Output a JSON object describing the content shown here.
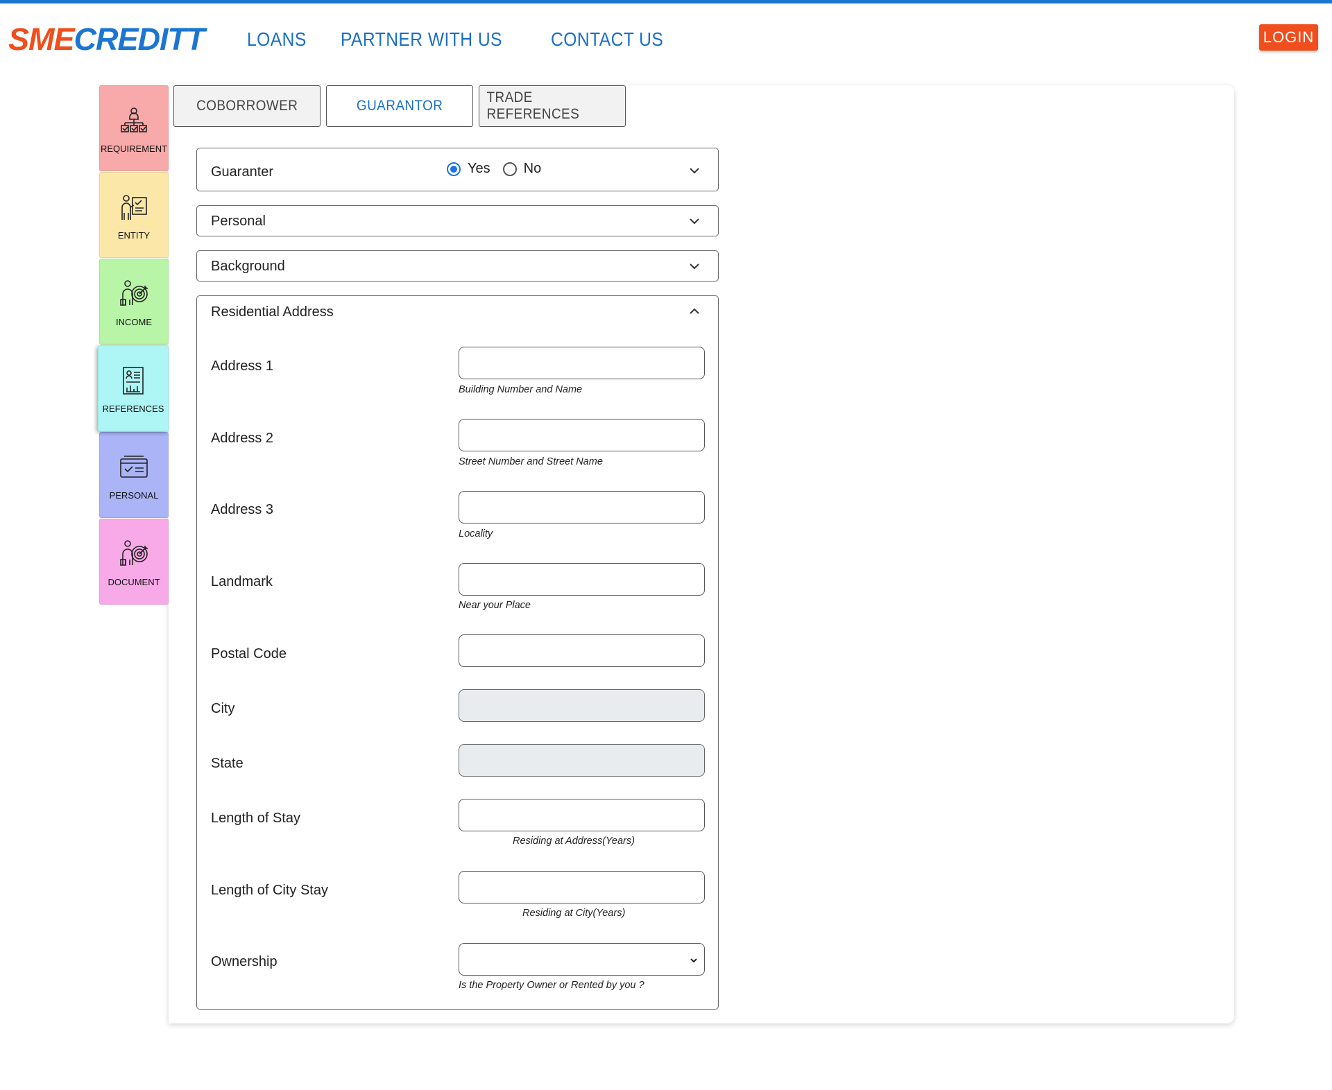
{
  "header": {
    "logo_part1": "SME",
    "logo_part2": "CREDITT",
    "nav": [
      "LOANS",
      "PARTNER WITH US",
      "CONTACT US"
    ],
    "login_label": "LOGIN"
  },
  "sidebar": {
    "items": [
      {
        "label": "REQUIREMENT",
        "color": "#f8a9a9",
        "icon": "org-check-icon"
      },
      {
        "label": "ENTITY",
        "color": "#fbe7a8",
        "icon": "presenter-icon"
      },
      {
        "label": "INCOME",
        "color": "#b8f5a6",
        "icon": "target-person-icon"
      },
      {
        "label": "REFERENCES",
        "color": "#aef6f6",
        "icon": "report-icon",
        "active": true
      },
      {
        "label": "PERSONAL",
        "color": "#aab4f6",
        "icon": "card-check-icon"
      },
      {
        "label": "DOCUMENT",
        "color": "#f8aae8",
        "icon": "target-person-icon"
      }
    ]
  },
  "tabs": [
    {
      "label": "COBORROWER",
      "active": false
    },
    {
      "label": "GUARANTOR",
      "active": true
    },
    {
      "label": "TRADE REFERENCES",
      "active": false
    }
  ],
  "guaranter": {
    "label": "Guaranter",
    "yes_label": "Yes",
    "no_label": "No",
    "selected": "Yes"
  },
  "sections": {
    "personal": "Personal",
    "background": "Background",
    "residential": "Residential Address"
  },
  "address_form": {
    "address1": {
      "label": "Address 1",
      "value": "",
      "hint": "Building Number and Name"
    },
    "address2": {
      "label": "Address 2",
      "value": "",
      "hint": "Street Number and Street Name"
    },
    "address3": {
      "label": "Address 3",
      "value": "",
      "hint": "Locality"
    },
    "landmark": {
      "label": "Landmark",
      "value": "",
      "hint": "Near your Place"
    },
    "postal": {
      "label": "Postal Code",
      "value": ""
    },
    "city": {
      "label": "City",
      "value": ""
    },
    "state": {
      "label": "State",
      "value": ""
    },
    "length_stay": {
      "label": "Length of Stay",
      "value": "",
      "hint": "Residing at Address(Years)"
    },
    "length_city_stay": {
      "label": "Length of City Stay",
      "value": "",
      "hint": "Residing at City(Years)"
    },
    "ownership": {
      "label": "Ownership",
      "value": "",
      "hint": "Is the Property Owner or Rented by you ?"
    }
  }
}
